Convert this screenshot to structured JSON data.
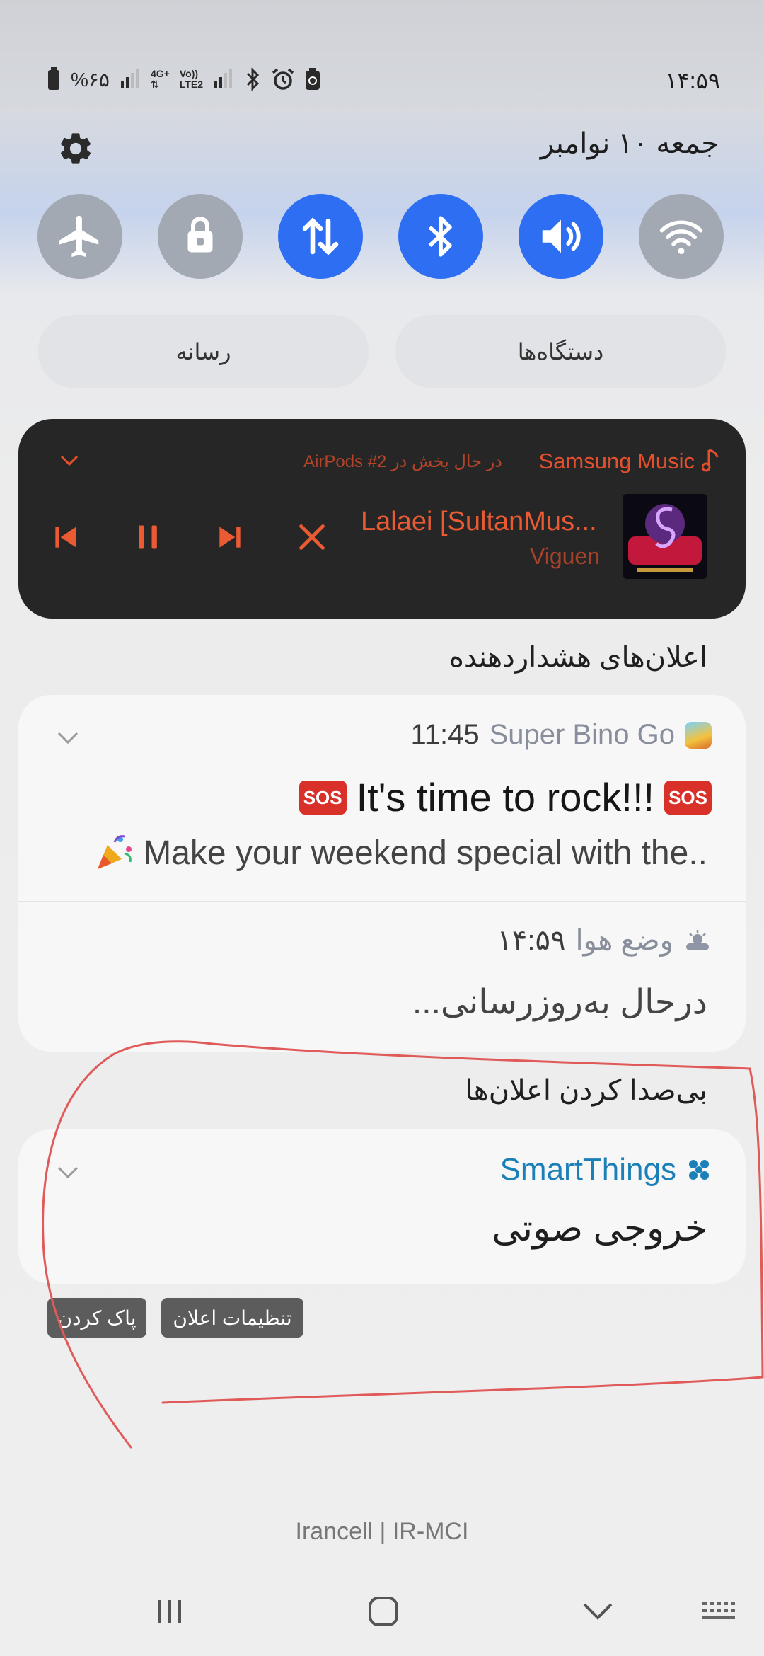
{
  "status_bar": {
    "time": "۱۴:۵۹",
    "battery": "%۶۵",
    "network_1": "4G+",
    "network_2": "LTE2",
    "volte": "Vo))"
  },
  "header": {
    "date": "جمعه ۱۰ نوامبر"
  },
  "quick_toggles": [
    {
      "icon": "wifi-icon",
      "state": "off"
    },
    {
      "icon": "sound-icon",
      "state": "on"
    },
    {
      "icon": "bluetooth-icon",
      "state": "on"
    },
    {
      "icon": "mobile-data-icon",
      "state": "on"
    },
    {
      "icon": "lock-rotation-icon",
      "state": "off"
    },
    {
      "icon": "airplane-icon",
      "state": "off"
    }
  ],
  "panels": {
    "devices": "دستگاه‌ها",
    "media": "رسانه"
  },
  "media_player": {
    "app": "Samsung Music",
    "device": "در حال پخش در AirPods #2",
    "title": "Lalaei [SultanMus...",
    "artist": "Viguen"
  },
  "alert_section": {
    "title": "اعلان‌های هشداردهنده"
  },
  "notification_game": {
    "app": "Super Bino Go",
    "time": "11:45",
    "sos_label": "SOS",
    "title": "It's time to rock!!!",
    "body": "Make your weekend special with the.."
  },
  "notification_weather": {
    "app": "وضع هوا",
    "time": "۱۴:۵۹",
    "body": "درحال به‌روزرسانی..."
  },
  "silent_section": {
    "title": "بی‌صدا کردن اعلان‌ها"
  },
  "notification_smartthings": {
    "app": "SmartThings",
    "body": "خروجی صوتی"
  },
  "actions": {
    "notification_settings": "تنظیمات اعلان",
    "clear": "پاک کردن"
  },
  "carrier": "Irancell | IR-MCI",
  "colors": {
    "toggle_on": "#2e6ef2",
    "toggle_off": "#a3a9b3",
    "media_accent": "#ea5b34",
    "smartthings": "#1b7fb8",
    "annotation": "#e05a5a"
  }
}
